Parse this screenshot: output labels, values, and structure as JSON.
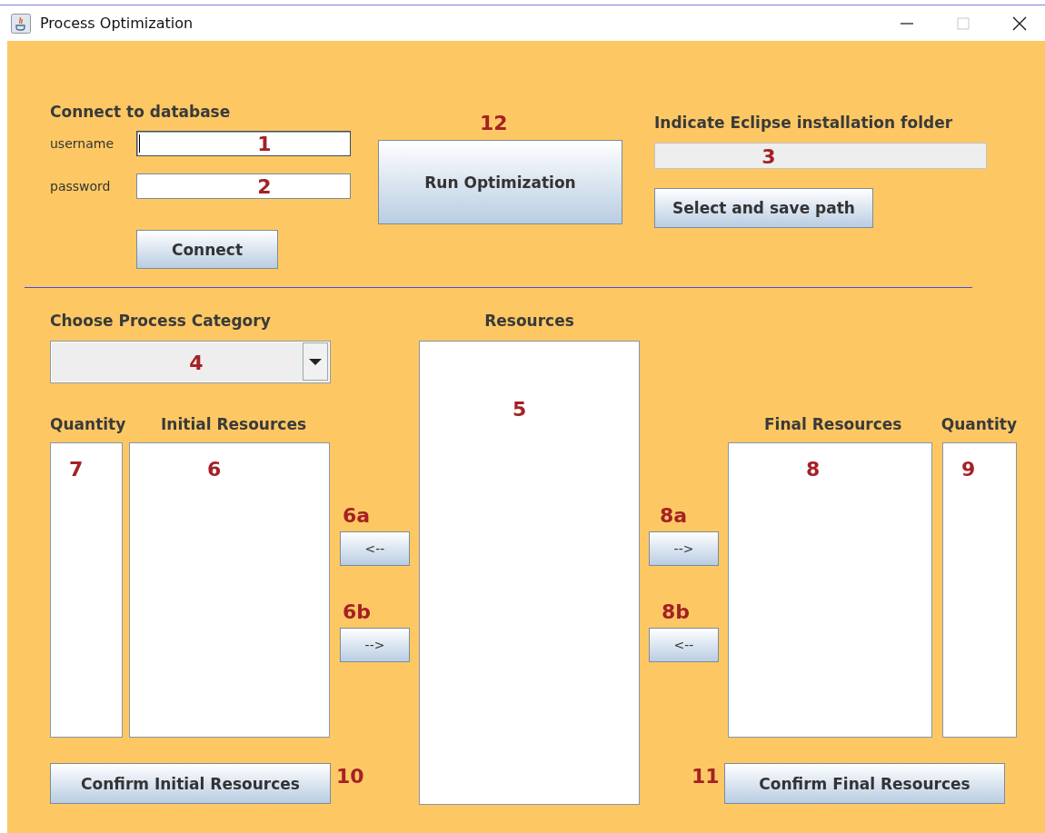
{
  "window": {
    "title": "Process Optimization"
  },
  "database": {
    "heading": "Connect to database",
    "fields": [
      {
        "label": "username",
        "annotation": "1",
        "focused": true
      },
      {
        "label": "password",
        "annotation": "2",
        "focused": false
      }
    ],
    "connect_button": "Connect"
  },
  "run": {
    "annotation": "12",
    "button": "Run Optimization"
  },
  "eclipse": {
    "label": "Indicate Eclipse installation folder",
    "field_annotation": "3",
    "button": "Select and save path"
  },
  "category": {
    "label": "Choose Process Category",
    "annotation": "4"
  },
  "resources": {
    "label": "Resources",
    "annotation": "5"
  },
  "initial": {
    "quantity_label": "Quantity",
    "quantity_annotation": "7",
    "label": "Initial Resources",
    "annotation": "6",
    "moves": [
      {
        "annotation": "6a",
        "button": "<--"
      },
      {
        "annotation": "6b",
        "button": "-->"
      }
    ],
    "confirm": {
      "button": "Confirm Initial Resources",
      "annotation": "10"
    }
  },
  "final": {
    "label": "Final Resources",
    "annotation": "8",
    "quantity_label": "Quantity",
    "quantity_annotation": "9",
    "moves": [
      {
        "annotation": "8a",
        "button": "-->"
      },
      {
        "annotation": "8b",
        "button": "<--"
      }
    ],
    "confirm": {
      "annotation": "11",
      "button": "Confirm Final Resources"
    }
  }
}
